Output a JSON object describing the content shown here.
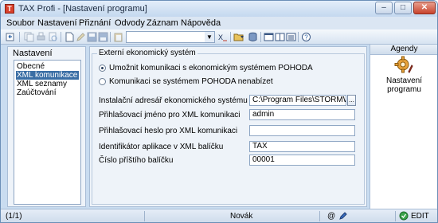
{
  "window": {
    "title": "TAX Profi - [Nastavení programu]",
    "app_icon_glyph": "T",
    "buttons": {
      "minimize": "–",
      "maximize": "□",
      "close": "✕"
    }
  },
  "menu": [
    "Soubor",
    "Nastavení",
    "Přiznání",
    "Odvody",
    "Záznam",
    "Nápověda"
  ],
  "toolbar": {
    "combo_value": "",
    "icons": [
      "back-icon",
      "copy-icon",
      "print-icon",
      "print-preview-icon",
      "new-document-icon",
      "edit-icon",
      "save-icon",
      "save-all-icon",
      "paste-icon",
      "format-icon",
      "open-folder-icon",
      "database-icon",
      "window-icon",
      "window-split-icon",
      "window-list-icon",
      "help-icon"
    ]
  },
  "left_panel": {
    "header": "Nastavení",
    "items": [
      "Obecné",
      "XML komunikace",
      "XML seznamy",
      "Zaúčtování"
    ],
    "selected_index": 1
  },
  "main_panel": {
    "group_title": "Externí ekonomický systém",
    "radio_options": [
      {
        "label": "Umožnit komunikaci s ekonomickým systémem POHODA",
        "checked": true
      },
      {
        "label": "Komunikaci se systémem POHODA nenabízet",
        "checked": false
      }
    ],
    "fields": [
      {
        "label": "Instalační adresář ekonomického systému POHODA",
        "value": "C:\\Program Files\\STORMWARE\\Poho"
      },
      {
        "label": "Přihlašovací jméno pro XML komunikaci",
        "value": "admin"
      },
      {
        "label": "Přihlašovací heslo pro XML komunikaci",
        "value": ""
      },
      {
        "label": "Identifikátor aplikace v XML balíčku",
        "value": "TAX"
      },
      {
        "label": "Číslo příštího balíčku",
        "value": "00001"
      }
    ],
    "browse_label": "..."
  },
  "agenda": {
    "header": "Agendy",
    "item_label": "Nastavení programu"
  },
  "status": {
    "record": "(1/1)",
    "mode": "Novák",
    "edit": "EDIT",
    "at_glyph": "@"
  },
  "colors": {
    "accent": "#3a6ea5",
    "frame": "#c9dcf0",
    "close_button": "#c8432c"
  }
}
